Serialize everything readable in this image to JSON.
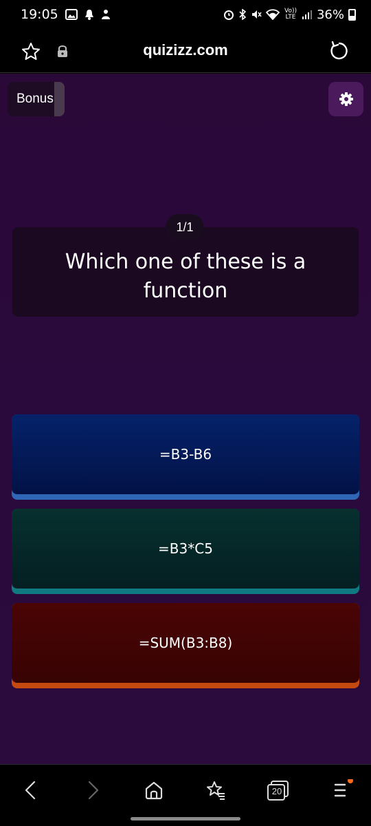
{
  "status_bar": {
    "time": "19:05",
    "battery": "36%",
    "left_icons": [
      "image-icon",
      "notification-bell-icon",
      "person-icon"
    ],
    "right_icons": [
      "alarm-icon",
      "bluetooth-icon",
      "mute-icon",
      "wifi-icon",
      "volte-icon",
      "signal-icon"
    ],
    "network_label": "Vo)) LTE"
  },
  "browser": {
    "url": "quizizz.com",
    "star_icon": "star-outline-icon",
    "lock_icon": "lock-icon",
    "reload_icon": "reload-icon"
  },
  "quiz": {
    "bonus_label": "Bonus",
    "settings_icon": "gear-icon",
    "counter": "1/1",
    "question": "Which one of these is a function",
    "options": [
      {
        "label": "=B3-B6",
        "color": "#2f66b5"
      },
      {
        "label": "=B3*C5",
        "color": "#0f7a82"
      },
      {
        "label": "=SUM(B3:B8)",
        "color": "#c44a10"
      }
    ]
  },
  "bottom_nav": {
    "tab_count": "20",
    "items": [
      "back-icon",
      "forward-icon",
      "home-icon",
      "bookmarks-icon",
      "tabs-icon",
      "menu-icon"
    ],
    "menu_badge_color": "#ff6a1a"
  }
}
